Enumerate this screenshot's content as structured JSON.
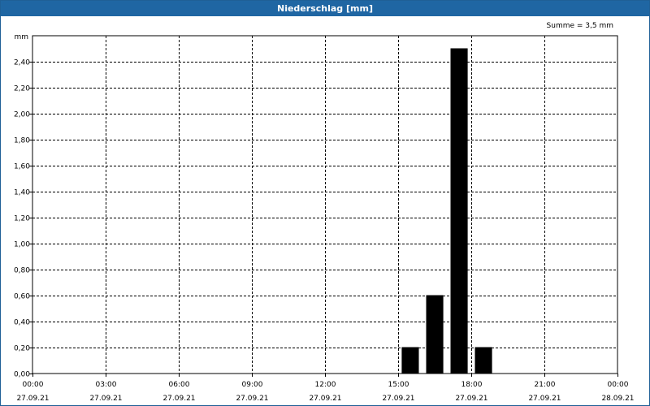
{
  "title": "Niederschlag [mm]",
  "summary": "Summe = 3,5 mm",
  "chart_data": {
    "type": "bar",
    "title": "Niederschlag [mm]",
    "ylabel": "mm",
    "ylim": [
      0,
      2.6
    ],
    "grid": true,
    "yticks": [
      "0,00",
      "0,20",
      "0,40",
      "0,60",
      "0,80",
      "1,00",
      "1,20",
      "1,40",
      "1,60",
      "1,80",
      "2,00",
      "2,20",
      "2,40"
    ],
    "xticks": [
      {
        "time": "00:00",
        "date": "27.09.21"
      },
      {
        "time": "03:00",
        "date": "27.09.21"
      },
      {
        "time": "06:00",
        "date": "27.09.21"
      },
      {
        "time": "09:00",
        "date": "27.09.21"
      },
      {
        "time": "12:00",
        "date": "27.09.21"
      },
      {
        "time": "15:00",
        "date": "27.09.21"
      },
      {
        "time": "18:00",
        "date": "27.09.21"
      },
      {
        "time": "21:00",
        "date": "27.09.21"
      },
      {
        "time": "00:00",
        "date": "28.09.21"
      }
    ],
    "x_range": [
      "27.09.21 00:00",
      "28.09.21 00:00"
    ],
    "bar_width_hours": 1,
    "series": [
      {
        "bars": [
          {
            "hour": 15,
            "value": 0.2
          },
          {
            "hour": 16,
            "value": 0.6
          },
          {
            "hour": 17,
            "value": 2.5
          },
          {
            "hour": 18,
            "value": 0.2
          }
        ]
      }
    ],
    "bar_color": "#000000"
  }
}
